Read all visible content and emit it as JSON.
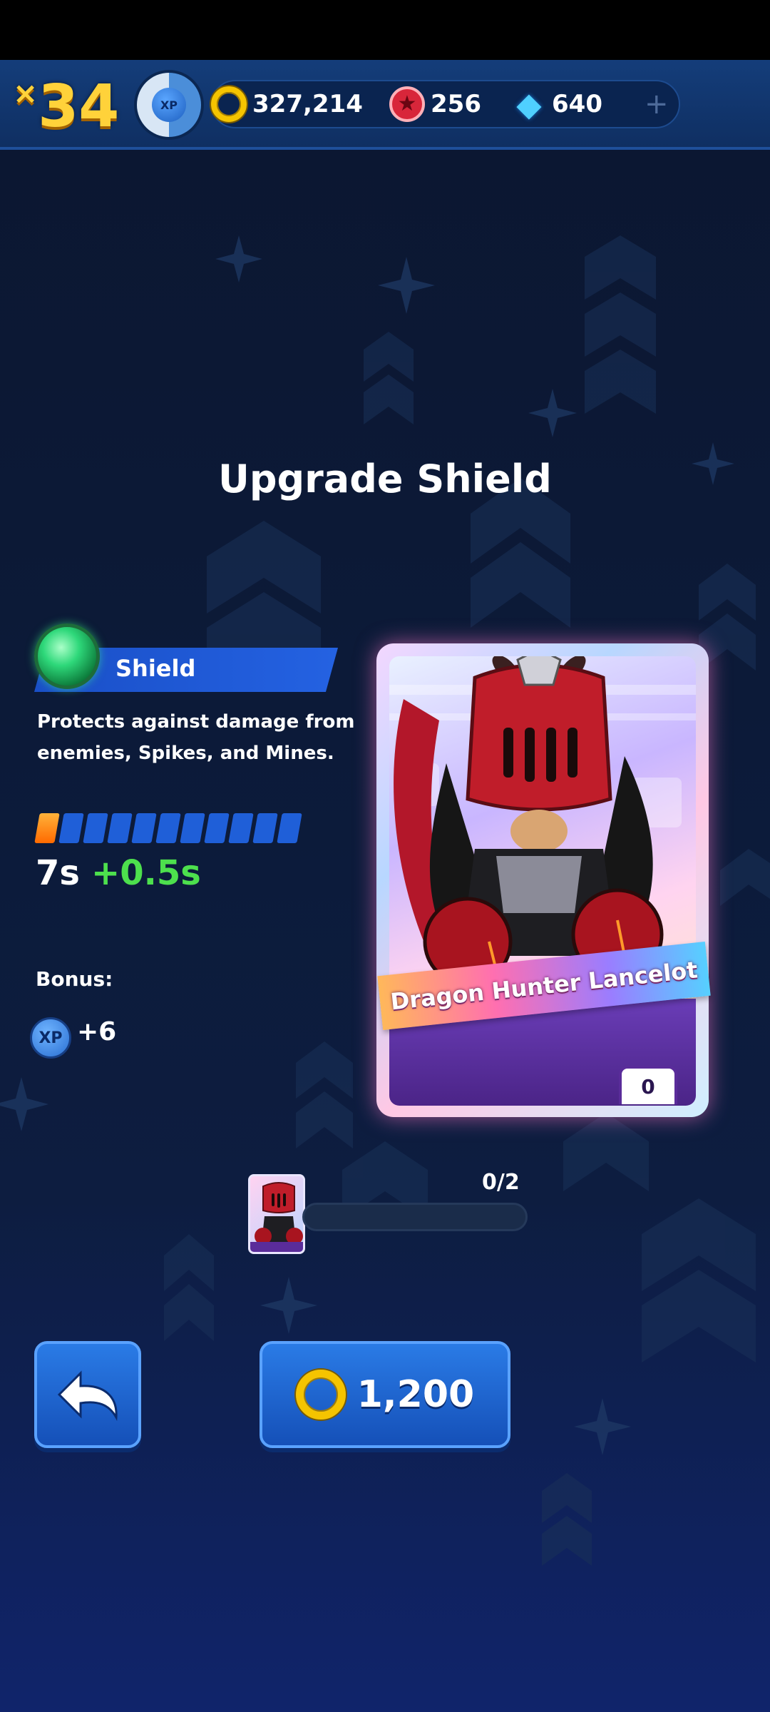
{
  "hud": {
    "multiplier_prefix": "×",
    "multiplier_value": "34",
    "xp_label": "XP",
    "xp_progress": 0.5,
    "rings_value": "327,214",
    "red_star_rings_value": "256",
    "gems_value": "640",
    "add_label": "+"
  },
  "title": "Upgrade Shield",
  "ability": {
    "name": "Shield",
    "description": "Protects against damage from enemies, Spikes, and Mines.",
    "level_filled": 1,
    "level_total": 11,
    "stat_current": "7s",
    "stat_increase": "+0.5s",
    "bonus_label": "Bonus:",
    "bonus_xp_label": "XP",
    "bonus_value": "+6"
  },
  "card": {
    "name": "Dragon Hunter Lancelot",
    "count": "0"
  },
  "upgrade_progress": {
    "label": "0/2",
    "fraction": 0
  },
  "buttons": {
    "price": "1,200"
  },
  "colors": {
    "accent_blue": "#2462e2",
    "ring_gold": "#f5c400",
    "increase_green": "#4de04d",
    "level_orange": "#ff8a1a"
  }
}
